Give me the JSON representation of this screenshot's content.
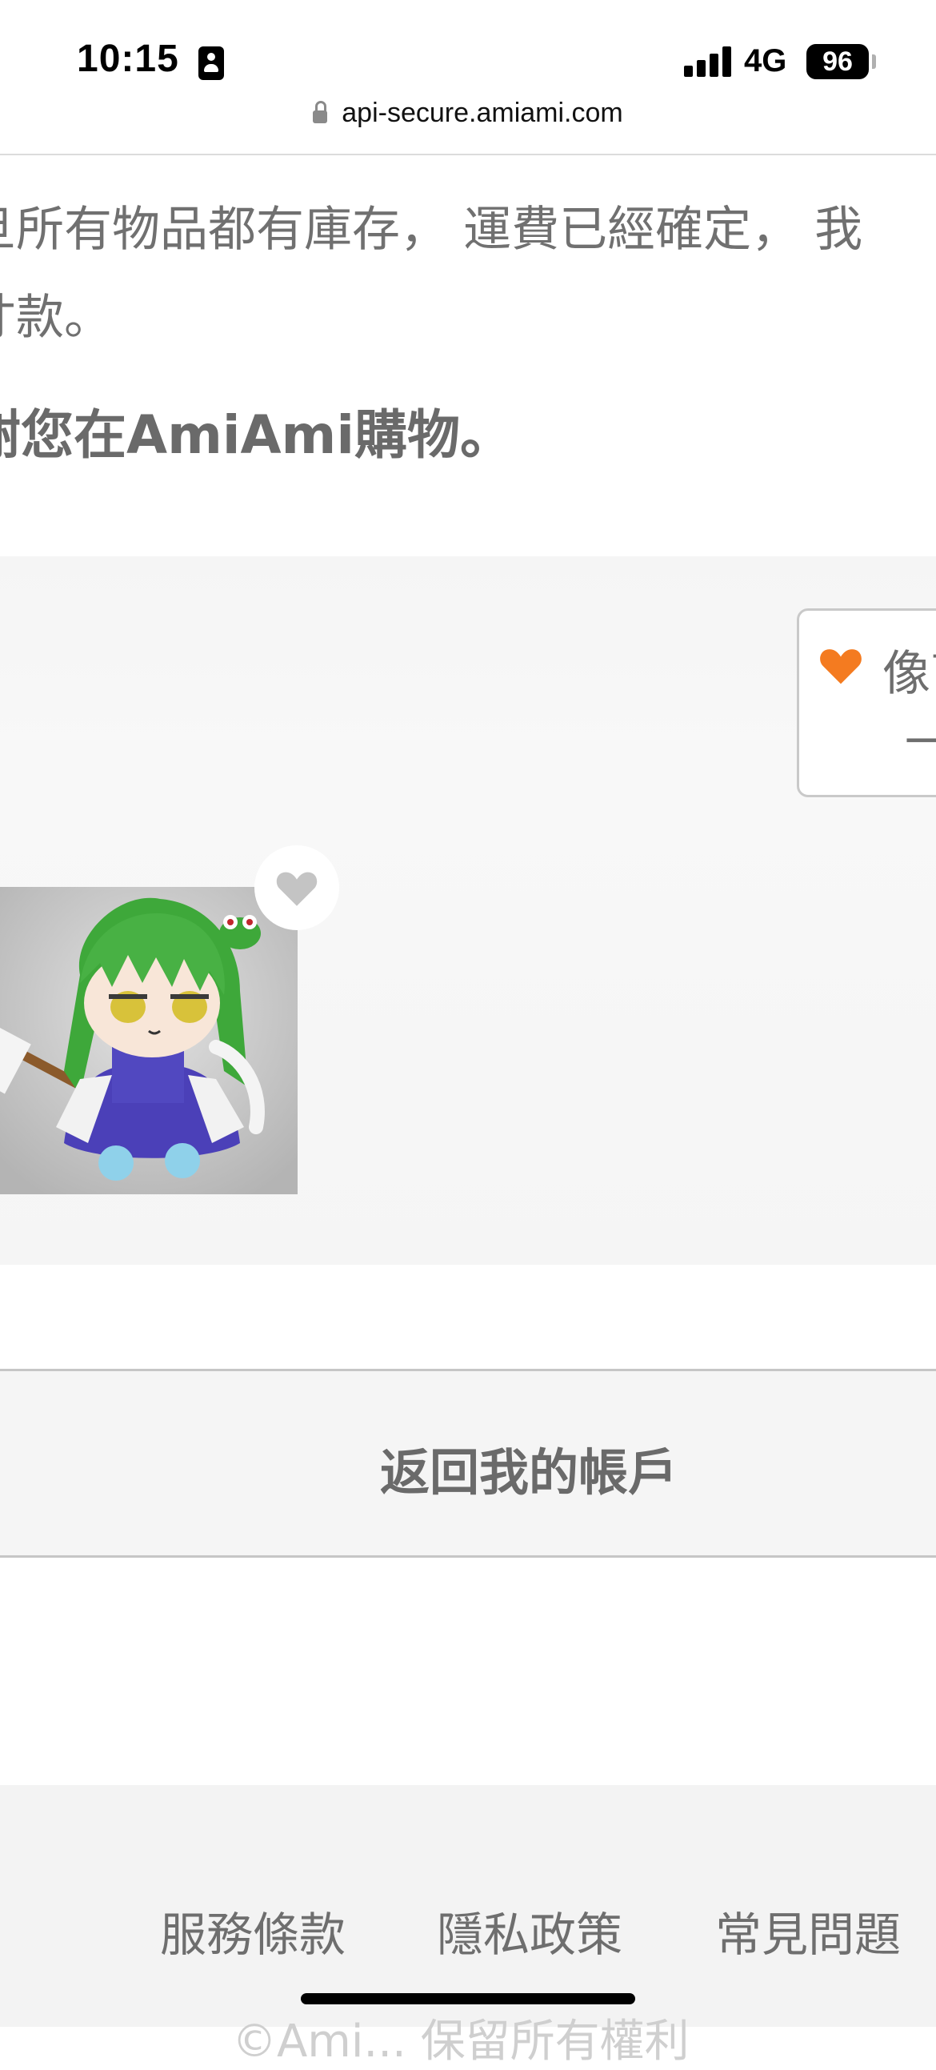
{
  "status_bar": {
    "time": "10:15",
    "network": "4G",
    "battery": "96",
    "sim_icon": "person-card-icon",
    "signal_icon": "signal-bars-icon"
  },
  "browser": {
    "url": "api-secure.amiami.com",
    "lock_icon": "lock-icon"
  },
  "message": {
    "line1": "旦所有物品都有庫存， 運費已經確定， 我",
    "line2": "寸款。",
    "thanks": "謝您在AmiAmi購物。"
  },
  "ranking_card": {
    "label": "像商",
    "value": "一",
    "heart_color": "#f47b20"
  },
  "product": {
    "favorite_icon": "heart-icon"
  },
  "back_button": {
    "label": "返回我的帳戶"
  },
  "footer": {
    "links": [
      "服務條款",
      "隱私政策",
      "常見問題"
    ],
    "copyright": "©Ami... 保留所有權利"
  }
}
